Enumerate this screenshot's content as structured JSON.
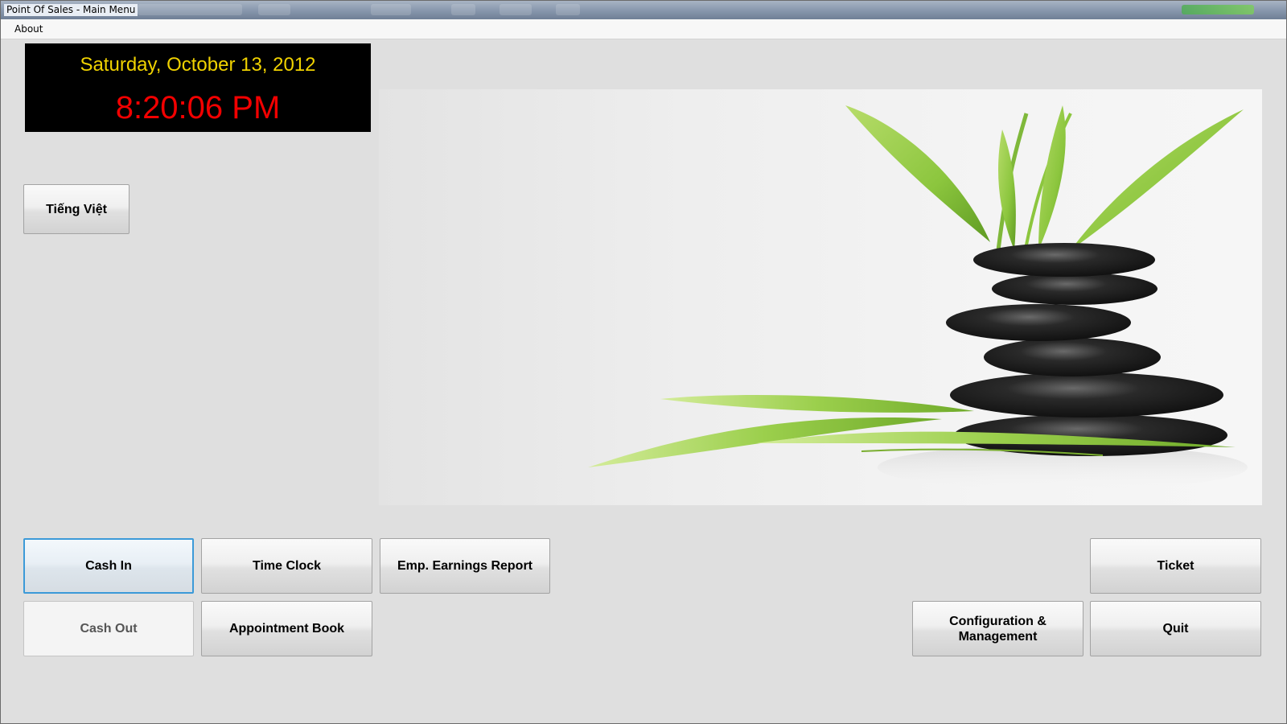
{
  "window": {
    "title": "Point Of Sales - Main Menu"
  },
  "menu": {
    "items": [
      {
        "label": "About"
      }
    ]
  },
  "clock": {
    "date": "Saturday, October 13, 2012",
    "time": "8:20:06 PM",
    "date_color": "#f0d200",
    "time_color": "#f20000"
  },
  "language_button": {
    "label": "Tiếng Việt"
  },
  "buttons": {
    "cash_in": "Cash In",
    "time_clock": "Time Clock",
    "emp_earnings_report": "Emp. Earnings Report",
    "cash_out": "Cash Out",
    "appointment_book": "Appointment Book",
    "ticket": "Ticket",
    "configuration_line1": "Configuration &",
    "configuration_line2": "Management",
    "quit": "Quit"
  },
  "colors": {
    "accent_focus": "#3c9ad8",
    "leaf_green": "#8cc63e",
    "stone_black": "#1e1e1e"
  }
}
